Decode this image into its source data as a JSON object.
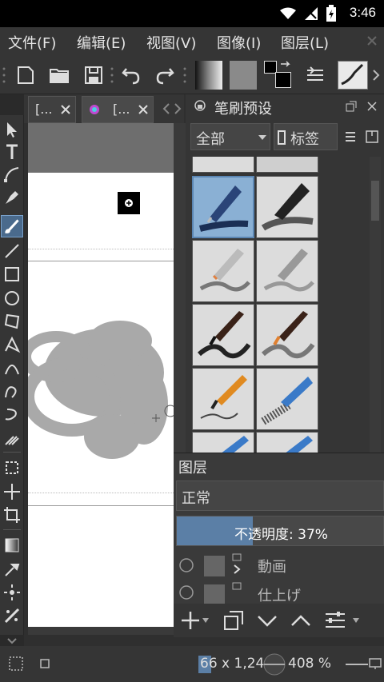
{
  "status_bar": {
    "time": "3:46"
  },
  "menu": [
    {
      "label": "文件(F)",
      "name": "menu-file"
    },
    {
      "label": "编辑(E)",
      "name": "menu-edit"
    },
    {
      "label": "视图(V)",
      "name": "menu-view"
    },
    {
      "label": "图像(I)",
      "name": "menu-image"
    },
    {
      "label": "图层(L)",
      "name": "menu-layer"
    }
  ],
  "tabs": [
    {
      "label": "[..."
    },
    {
      "label": "[..."
    }
  ],
  "brush_docker": {
    "title": "笔刷预设",
    "filter": "全部",
    "tag_label": "标签"
  },
  "layers_docker": {
    "title": "图层",
    "blend_mode": "正常",
    "opacity_label": "不透明度: 37%",
    "opacity": 0.37,
    "layers": [
      {
        "name": "動画"
      },
      {
        "name": "仕上げ"
      }
    ]
  },
  "bottom_status": {
    "zoom_text": "66 x 1,24",
    "rotation_text": "408 %"
  },
  "colors": {
    "bg": "#2f2f2f",
    "panel": "#353535",
    "accent": "#5b7fa6",
    "canvas": "#ffffff"
  }
}
